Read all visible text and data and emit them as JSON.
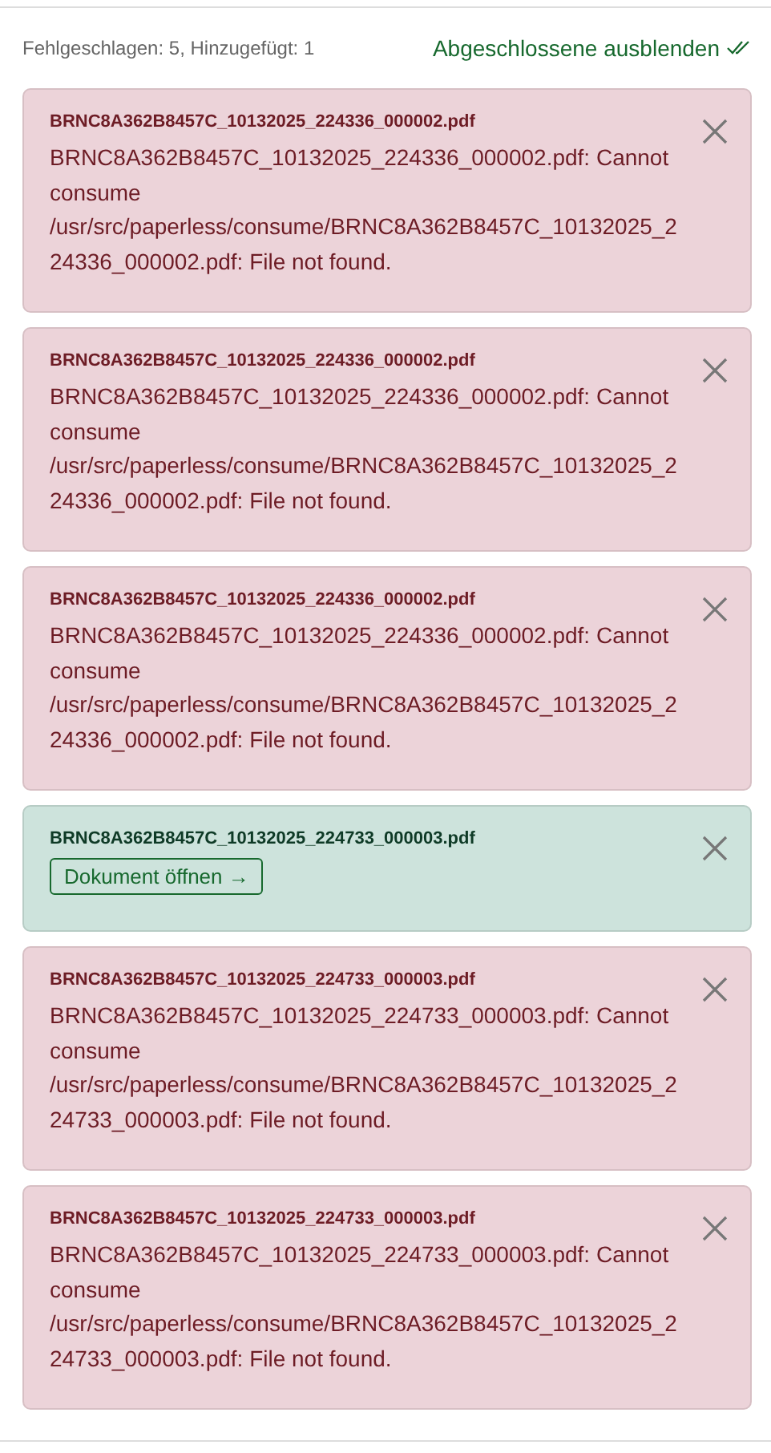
{
  "summary": "Fehlgeschlagen: 5, Hinzugefügt: 1",
  "hide_completed_link": "Abgeschlossene ausblenden",
  "notifications": [
    {
      "kind": "failed",
      "filename": "BRNC8A362B8457C_10132025_224336_000002.pdf",
      "message": "BRNC8A362B8457C_10132025_224336_000002.pdf: Cannot consume /usr/src/paperless/consume/BRNC8A362B8457C_10132025_224336_000002.pdf: File not found."
    },
    {
      "kind": "failed",
      "filename": "BRNC8A362B8457C_10132025_224336_000002.pdf",
      "message": "BRNC8A362B8457C_10132025_224336_000002.pdf: Cannot consume /usr/src/paperless/consume/BRNC8A362B8457C_10132025_224336_000002.pdf: File not found."
    },
    {
      "kind": "failed",
      "filename": "BRNC8A362B8457C_10132025_224336_000002.pdf",
      "message": "BRNC8A362B8457C_10132025_224336_000002.pdf: Cannot consume /usr/src/paperless/consume/BRNC8A362B8457C_10132025_224336_000002.pdf: File not found."
    },
    {
      "kind": "added",
      "filename": "BRNC8A362B8457C_10132025_224733_000003.pdf",
      "action": "Dokument öffnen →"
    },
    {
      "kind": "failed",
      "filename": "BRNC8A362B8457C_10132025_224733_000003.pdf",
      "message": "BRNC8A362B8457C_10132025_224733_000003.pdf: Cannot consume /usr/src/paperless/consume/BRNC8A362B8457C_10132025_224733_000003.pdf: File not found."
    },
    {
      "kind": "failed",
      "filename": "BRNC8A362B8457C_10132025_224733_000003.pdf",
      "message": "BRNC8A362B8457C_10132025_224733_000003.pdf: Cannot consume /usr/src/paperless/consume/BRNC8A362B8457C_10132025_224733_000003.pdf: File not found."
    }
  ]
}
